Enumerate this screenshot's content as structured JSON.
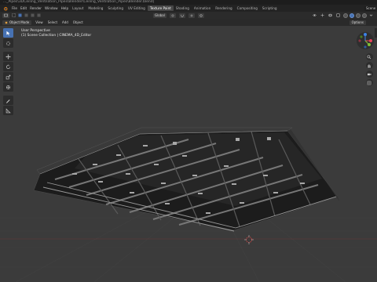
{
  "window": {
    "title": "..._Pipes\\3DCeiling_Ventilation_Pipes\\Blender\\Ceiling_Ventilation_Pipes\\Blender.blend]"
  },
  "menubar": {
    "workspace_tabs": [
      "File",
      "Edit",
      "Render",
      "Window",
      "Help",
      "Layout",
      "Modeling",
      "Sculpting",
      "UV Editing",
      "Texture Paint",
      "Shading",
      "Animation",
      "Rendering",
      "Compositing",
      "Scripting"
    ],
    "active_tab": "Texture Paint",
    "scene_label": "Scene"
  },
  "header": {
    "transform_orientation": "Global",
    "options_label": "Options"
  },
  "subheader": {
    "mode": "Object Mode",
    "menus": [
      "View",
      "Select",
      "Add",
      "Object"
    ]
  },
  "viewport": {
    "view_name": "User Perspective",
    "collection_info": "(1) Scene Collection | CINEMA_4D_Editor"
  },
  "gizmo": {
    "x_color": "#e5435a",
    "y_color": "#7fbd37",
    "z_color": "#3d83e6"
  },
  "colors": {
    "accent": "#4772b3",
    "viewport_bg": "#3b3b3b",
    "grid": "#444444"
  }
}
